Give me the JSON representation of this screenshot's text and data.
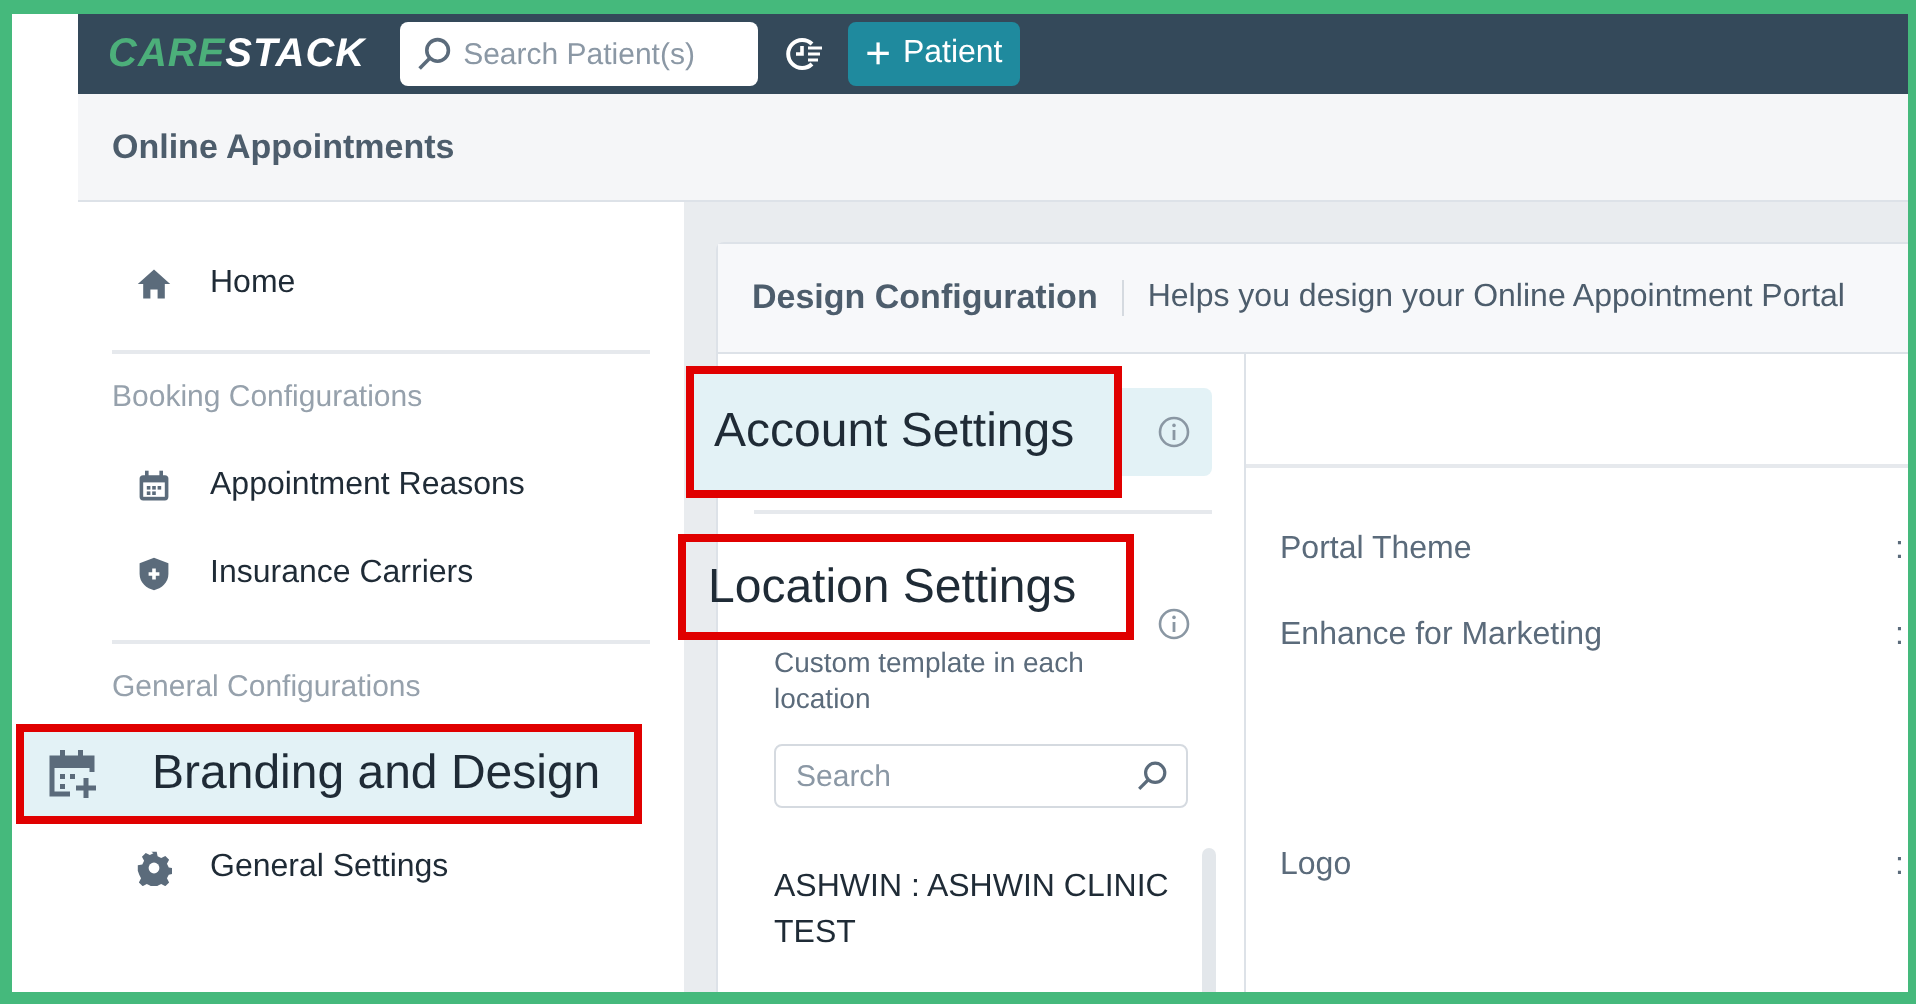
{
  "top_bar": {
    "logo": [
      {
        "text": "CARE",
        "color": "#4caf7a"
      },
      {
        "text": "STACK",
        "color": "#ffffff"
      }
    ],
    "search": {
      "placeholder": "Search Patient(s)"
    },
    "add_button": {
      "icon": "+",
      "label": "Patient"
    }
  },
  "page_header": {
    "title": "Online Appointments"
  },
  "sidebar": {
    "items": [
      {
        "kind": "item",
        "label": "Home",
        "selected": false,
        "annotated": false
      },
      {
        "kind": "divider"
      },
      {
        "kind": "heading",
        "label": "Booking Configurations"
      },
      {
        "kind": "item",
        "label": "Appointment Reasons",
        "selected": false,
        "annotated": false
      },
      {
        "kind": "item",
        "label": "Insurance Carriers",
        "selected": false,
        "annotated": false
      },
      {
        "kind": "divider"
      },
      {
        "kind": "heading",
        "label": "General Configurations"
      },
      {
        "kind": "item",
        "label": "Branding and Design",
        "selected": true,
        "annotated": true
      },
      {
        "kind": "item",
        "label": "General Settings",
        "selected": false,
        "annotated": false
      }
    ]
  },
  "card": {
    "title": "Design Configuration",
    "description": "Helps you design your Online Appointment Portal",
    "account_settings": {
      "label": "Account Settings",
      "selected": true,
      "annotated": true
    },
    "location_settings": {
      "label": "Location Settings",
      "annotated": true,
      "description": "Custom template in each location"
    },
    "location_search": {
      "placeholder": "Search"
    },
    "locations": [
      {
        "label": "ASHWIN : ASHWIN CLINIC TEST"
      }
    ],
    "fields": [
      {
        "label": "Portal Theme",
        "separator": ":"
      },
      {
        "label": "Enhance for Marketing",
        "separator": ":"
      },
      {
        "label": "Logo",
        "separator": ":"
      }
    ]
  }
}
